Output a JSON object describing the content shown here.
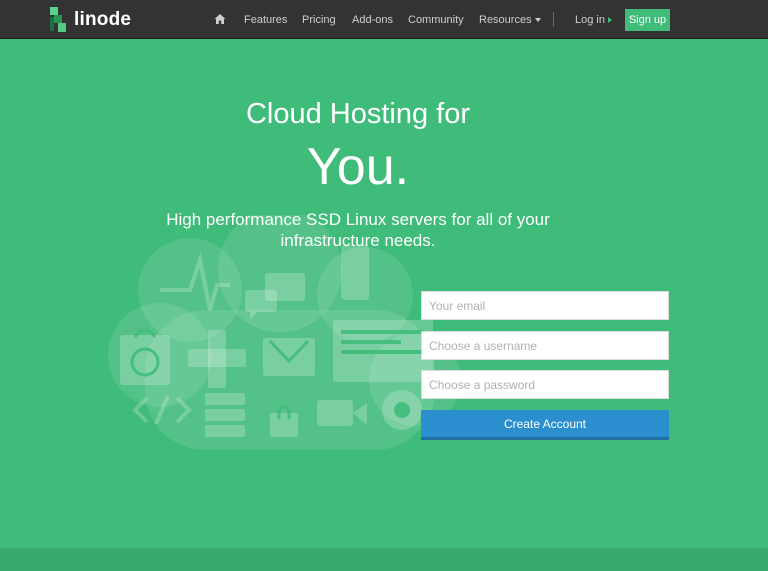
{
  "brand": {
    "name": "linode"
  },
  "nav": {
    "items": [
      {
        "label": "Features"
      },
      {
        "label": "Pricing"
      },
      {
        "label": "Add-ons"
      },
      {
        "label": "Community"
      },
      {
        "label": "Resources"
      }
    ],
    "login_label": "Log in",
    "signup_label": "Sign up"
  },
  "hero": {
    "line1": "Cloud Hosting for",
    "line2": "You.",
    "subtitle": "High performance SSD Linux servers for all of your infrastructure needs."
  },
  "form": {
    "email_placeholder": "Your email",
    "username_placeholder": "Choose a username",
    "password_placeholder": "Choose a password",
    "submit_label": "Create Account"
  },
  "colors": {
    "background": "#3fbb7a",
    "navbar": "#333333",
    "button_blue": "#2b8ecf",
    "signup_green": "#3fbb7a"
  },
  "icons": [
    "home-icon",
    "caret-down-icon",
    "arrow-right-icon",
    "pulse-icon",
    "chat-icon",
    "phone-icon",
    "shopping-bag-icon",
    "globe-icon",
    "plus-cross-icon",
    "envelope-icon",
    "browser-window-icon",
    "code-icon",
    "server-stack-icon",
    "lock-icon",
    "video-camera-icon",
    "gear-icon"
  ]
}
